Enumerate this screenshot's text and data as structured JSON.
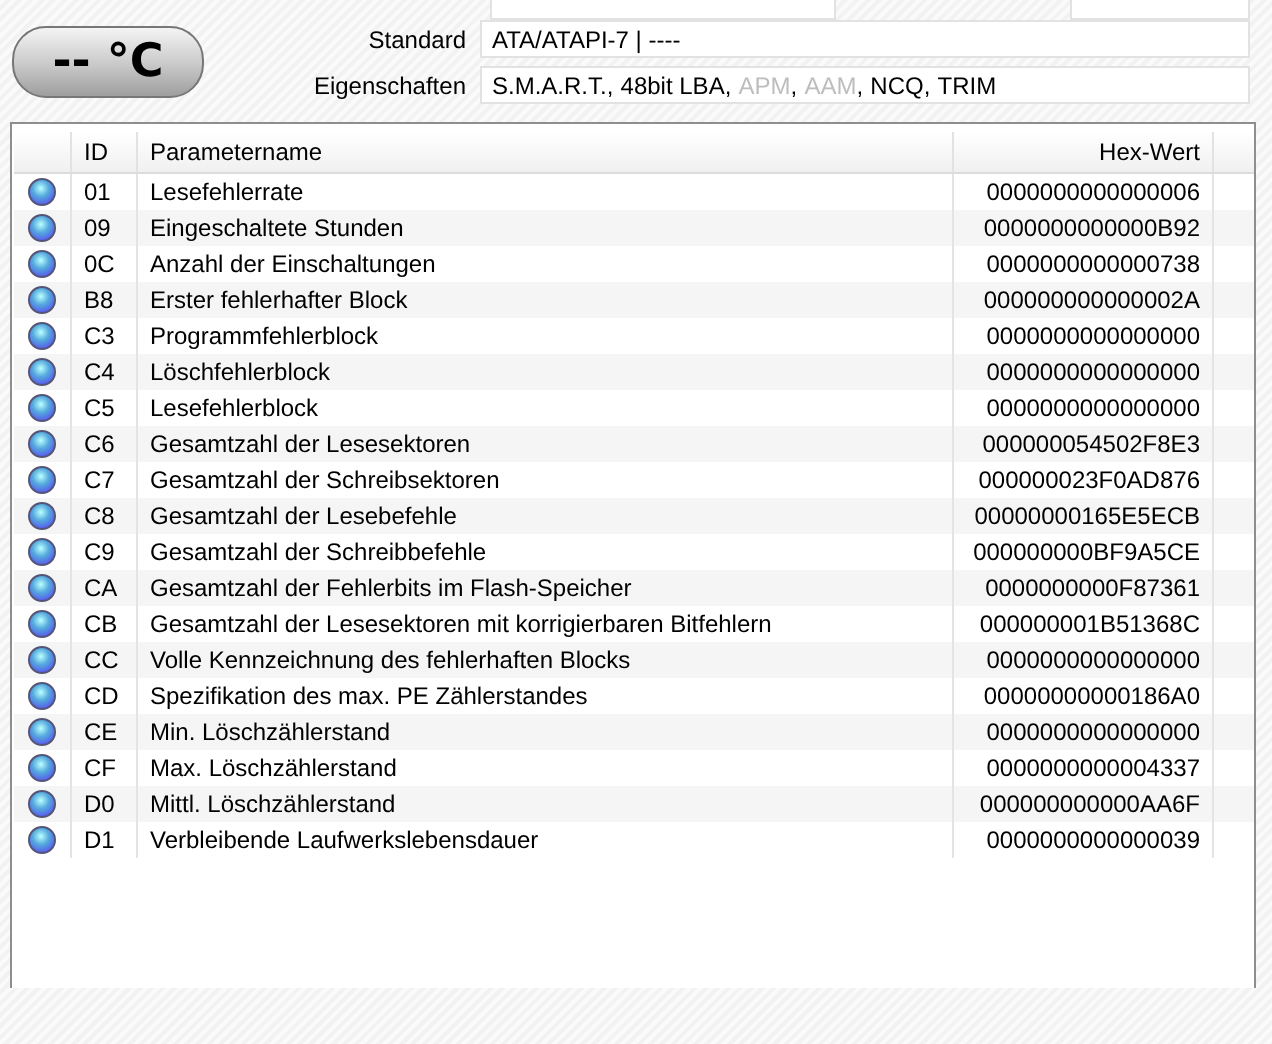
{
  "temperature": "-- °C",
  "standard": {
    "label": "Standard",
    "value": "ATA/ATAPI-7 | ----"
  },
  "features": {
    "label": "Eigenschaften",
    "separator": ",",
    "items": [
      {
        "text": "S.M.A.R.T.",
        "enabled": true
      },
      {
        "text": "48bit LBA",
        "enabled": true
      },
      {
        "text": "APM",
        "enabled": false
      },
      {
        "text": "AAM",
        "enabled": false
      },
      {
        "text": "NCQ",
        "enabled": true
      },
      {
        "text": "TRIM",
        "enabled": true
      }
    ]
  },
  "table": {
    "columns": [
      "ID",
      "Parametername",
      "Hex-Wert"
    ],
    "rows": [
      {
        "id": "01",
        "name": "Lesefehlerrate",
        "hex": "0000000000000006"
      },
      {
        "id": "09",
        "name": "Eingeschaltete Stunden",
        "hex": "0000000000000B92"
      },
      {
        "id": "0C",
        "name": "Anzahl der Einschaltungen",
        "hex": "0000000000000738"
      },
      {
        "id": "B8",
        "name": "Erster fehlerhafter Block",
        "hex": "000000000000002A"
      },
      {
        "id": "C3",
        "name": "Programmfehlerblock",
        "hex": "0000000000000000"
      },
      {
        "id": "C4",
        "name": "Löschfehlerblock",
        "hex": "0000000000000000"
      },
      {
        "id": "C5",
        "name": "Lesefehlerblock",
        "hex": "0000000000000000"
      },
      {
        "id": "C6",
        "name": "Gesamtzahl der Lesesektoren",
        "hex": "000000054502F8E3"
      },
      {
        "id": "C7",
        "name": "Gesamtzahl der Schreibsektoren",
        "hex": "000000023F0AD876"
      },
      {
        "id": "C8",
        "name": "Gesamtzahl der Lesebefehle",
        "hex": "00000000165E5ECB"
      },
      {
        "id": "C9",
        "name": "Gesamtzahl der Schreibbefehle",
        "hex": "000000000BF9A5CE"
      },
      {
        "id": "CA",
        "name": "Gesamtzahl der Fehlerbits im Flash-Speicher",
        "hex": "0000000000F87361"
      },
      {
        "id": "CB",
        "name": "Gesamtzahl der Lesesektoren mit korrigierbaren Bitfehlern",
        "hex": "000000001B51368C"
      },
      {
        "id": "CC",
        "name": "Volle Kennzeichnung des fehlerhaften Blocks",
        "hex": "0000000000000000"
      },
      {
        "id": "CD",
        "name": "Spezifikation des max. PE Zählerstandes",
        "hex": "00000000000186A0"
      },
      {
        "id": "CE",
        "name": "Min. Löschzählerstand",
        "hex": "0000000000000000"
      },
      {
        "id": "CF",
        "name": "Max. Löschzählerstand",
        "hex": "0000000000004337"
      },
      {
        "id": "D0",
        "name": "Mittl. Löschzählerstand",
        "hex": "000000000000AA6F"
      },
      {
        "id": "D1",
        "name": "Verbleibende Laufwerkslebensdauer",
        "hex": "0000000000000039"
      }
    ]
  }
}
